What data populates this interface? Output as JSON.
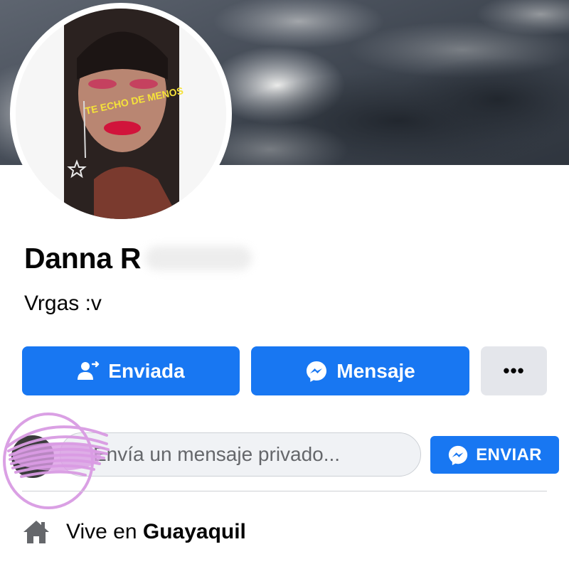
{
  "profile": {
    "name": "Danna R",
    "bio": "Vrgas :v",
    "avatar_sticker_text": "TE ECHO DE MENOS"
  },
  "actions": {
    "sent_label": "Enviada",
    "message_label": "Mensaje",
    "more_label": "•••"
  },
  "composer": {
    "placeholder": "Envía un mensaje privado...",
    "send_label": "ENVIAR"
  },
  "info": {
    "lives_prefix": "Vive en ",
    "lives_city": "Guayaquil"
  },
  "icons": {
    "sent": "person-check-icon",
    "message": "messenger-icon",
    "more": "more-dots-icon",
    "send": "messenger-icon",
    "home": "home-icon"
  },
  "colors": {
    "primary": "#1877f2",
    "secondary_button": "#e4e6eb",
    "text": "#050505",
    "muted_text": "#65676b",
    "scribble": "#d99be3"
  }
}
